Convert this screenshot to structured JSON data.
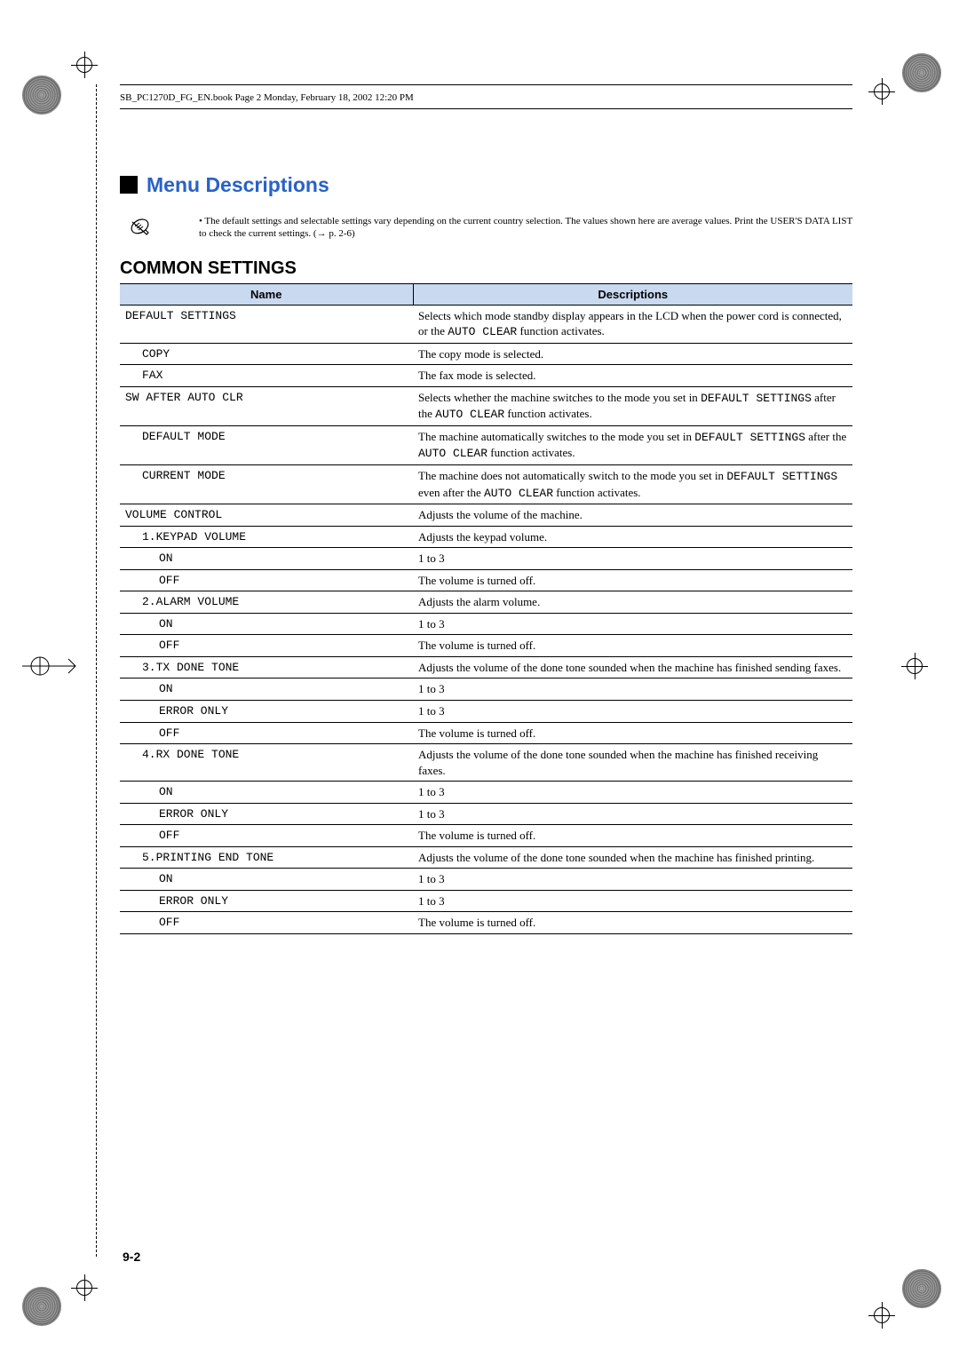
{
  "book_info": "SB_PC1270D_FG_EN.book  Page 2  Monday, February 18, 2002  12:20 PM",
  "section_title": "Menu Descriptions",
  "note_bullet": "•",
  "note_text": "The default settings and selectable settings vary depending on the current country selection. The values shown here are average values. Print the USER'S DATA LIST to check the current settings. (→ p. 2-6)",
  "subsection_title": "COMMON SETTINGS",
  "header_name": "Name",
  "header_desc": "Descriptions",
  "rows": [
    {
      "name": "DEFAULT SETTINGS",
      "desc_pre": "Selects which mode standby display appears in the LCD when the power cord is connected, or the ",
      "desc_mono": "AUTO CLEAR",
      "desc_post": " function activates.",
      "indent": 0
    },
    {
      "name": "COPY",
      "desc": "The copy mode is selected.",
      "indent": 1
    },
    {
      "name": "FAX",
      "desc": "The fax mode is selected.",
      "indent": 1
    },
    {
      "name": "SW AFTER AUTO CLR",
      "desc_pre": "Selects whether the machine switches to the mode you set in ",
      "desc_mono": "DEFAULT SETTINGS",
      "desc_mid": " after the ",
      "desc_mono2": "AUTO CLEAR",
      "desc_post": " function activates.",
      "indent": 0
    },
    {
      "name": "DEFAULT MODE",
      "desc_pre": "The machine automatically switches to the mode you set in ",
      "desc_mono": "DEFAULT SETTINGS",
      "desc_mid": " after the ",
      "desc_mono2": "AUTO CLEAR",
      "desc_post": " function activates.",
      "indent": 1
    },
    {
      "name": "CURRENT MODE",
      "desc_pre": "The machine does not automatically switch to the mode you set in ",
      "desc_mono": "DEFAULT SETTINGS",
      "desc_mid": " even after the ",
      "desc_mono2": "AUTO CLEAR",
      "desc_post": " function activates.",
      "indent": 1
    },
    {
      "name": "VOLUME CONTROL",
      "desc": "Adjusts the volume of the machine.",
      "indent": 0
    },
    {
      "name": "1.KEYPAD VOLUME",
      "desc": "Adjusts the keypad volume.",
      "indent": 1
    },
    {
      "name": "ON",
      "desc": "1 to 3",
      "indent": 2
    },
    {
      "name": "OFF",
      "desc": "The volume is turned off.",
      "indent": 2
    },
    {
      "name": "2.ALARM VOLUME",
      "desc": "Adjusts the alarm volume.",
      "indent": 1
    },
    {
      "name": "ON",
      "desc": "1 to 3",
      "indent": 2
    },
    {
      "name": "OFF",
      "desc": "The volume is turned off.",
      "indent": 2
    },
    {
      "name": "3.TX DONE TONE",
      "desc": "Adjusts the volume of the done tone sounded when the machine has finished sending faxes.",
      "indent": 1
    },
    {
      "name": "ON",
      "desc": "1 to 3",
      "indent": 2
    },
    {
      "name": "ERROR ONLY",
      "desc": "1 to 3",
      "indent": 2
    },
    {
      "name": "OFF",
      "desc": "The volume is turned off.",
      "indent": 2
    },
    {
      "name": "4.RX DONE TONE",
      "desc": "Adjusts the volume of the done tone sounded when the machine has finished receiving faxes.",
      "indent": 1
    },
    {
      "name": "ON",
      "desc": "1 to 3",
      "indent": 2
    },
    {
      "name": "ERROR ONLY",
      "desc": "1 to 3",
      "indent": 2
    },
    {
      "name": "OFF",
      "desc": "The volume is turned off.",
      "indent": 2
    },
    {
      "name": "5.PRINTING END TONE",
      "desc": "Adjusts the volume of the done tone sounded when the machine has finished printing.",
      "indent": 1
    },
    {
      "name": "ON",
      "desc": "1 to 3",
      "indent": 2
    },
    {
      "name": "ERROR ONLY",
      "desc": "1 to 3",
      "indent": 2
    },
    {
      "name": "OFF",
      "desc": "The volume is turned off.",
      "indent": 2
    }
  ],
  "page_number": "9-2"
}
